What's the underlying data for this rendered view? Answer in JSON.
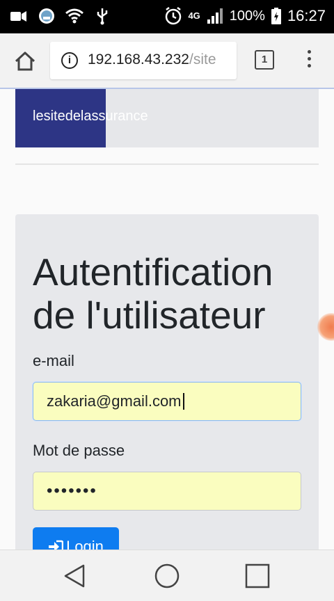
{
  "status_bar": {
    "battery": "100%",
    "time": "16:27",
    "network": "4G"
  },
  "browser": {
    "url_host": "192.168.43.232",
    "url_path": "/site",
    "tab_count": "1"
  },
  "site": {
    "brand": "lesitedelassurance"
  },
  "login_form": {
    "title": "Autentification de l'utilisateur",
    "email_label": "e-mail",
    "email_value": "zakaria@gmail.com",
    "password_label": "Mot de passe",
    "password_value": "•••••••",
    "login_label": "Login"
  },
  "colors": {
    "brand_bg": "#2d3585",
    "button_bg": "#0e7cf0",
    "field_bg": "#fafdbf"
  }
}
